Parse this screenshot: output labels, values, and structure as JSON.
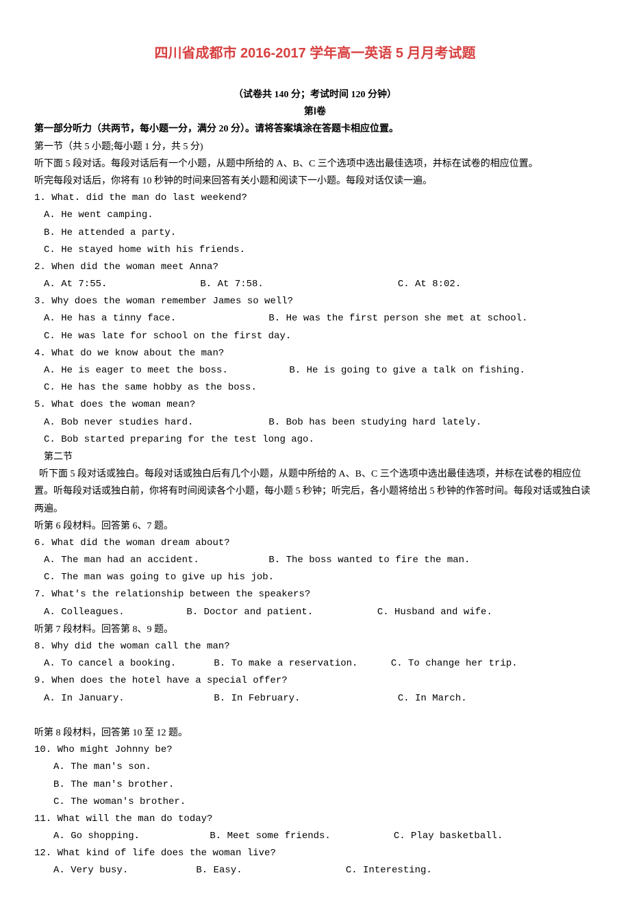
{
  "title": "四川省成都市 2016-2017 学年高一英语 5 月月考试题",
  "meta": "（试卷共 140 分；考试时间 120 分钟）",
  "volume": "第Ⅰ卷",
  "part1_header": "第一部分听力（共两节，每小题一分，满分 20 分）。请将答案填涂在答题卡相应位置。",
  "sec1_header": "第一节（共 5 小题;每小题 1 分，共 5 分)",
  "sec1_instr1": "听下面 5 段对话。每段对话后有一个小题，从题中所给的 A、B、C 三个选项中选出最佳选项，并标在试卷的相应位置。",
  "sec1_instr2": "听完每段对话后，你将有 10 秒钟的时间来回答有关小题和阅读下一小题。每段对话仅读一遍。",
  "q1": {
    "stem": "1. What. did the man do last weekend?",
    "a": "A. He went camping.",
    "b": "B. He attended a party.",
    "c": "C. He stayed home with his friends."
  },
  "q2": {
    "stem": "2. When did the woman meet Anna?",
    "a": "A. At 7:55.",
    "b": "B. At 7:58.",
    "c": "C. At 8:02."
  },
  "q3": {
    "stem": "3. Why does the woman remember James so well?",
    "a": "A. He has a tinny face.",
    "b": "B. He was the first person she met at school.",
    "c": "C. He was late for school on the first day."
  },
  "q4": {
    "stem": "4. What do we know about the man?",
    "a": "A. He is eager to meet the boss.",
    "b": "B. He is going to give a talk on fishing.",
    "c": "C. He has the same hobby as the boss."
  },
  "q5": {
    "stem": "5. What does the woman mean?",
    "a": "A. Bob never studies hard.",
    "b": "B. Bob has been studying hard lately.",
    "c": "C. Bob started preparing for the test long ago."
  },
  "sec2_header": "第二节",
  "sec2_instr": "  听下面 5 段对话或独白。每段对话或独白后有几个小题，从题中所给的 A、B、C 三个选项中选出最佳选项，并标在试卷的相应位置。听每段对话或独白前，你将有时间阅读各个小题，每小题 5 秒钟；听完后，各小题将给出 5 秒钟的作答时间。每段对话或独白读两遍。",
  "mat6": "听第 6 段材料。回答第 6、7 题。",
  "q6": {
    "stem": "6. What did the woman dream about?",
    "a": "A. The man had an accident.",
    "b": "B. The boss wanted to fire the man.",
    "c": "C. The man was going to give up his job."
  },
  "q7": {
    "stem": "7. What's the relationship between the speakers?",
    "a": "A. Colleagues.",
    "b": "B. Doctor and patient.",
    "c": "C. Husband and wife."
  },
  "mat7": "听第 7 段材料。回答第 8、9 题。",
  "q8": {
    "stem": "8. Why did the woman call the man?",
    "a": "A. To cancel a booking.",
    "b": "B. To make a reservation.",
    "c": "C. To change her trip."
  },
  "q9": {
    "stem": "9. When does the hotel have a special offer?",
    "a": "A. In January.",
    "b": "B. In February.",
    "c": "C. In March."
  },
  "mat8": "听第 8 段材料，回答第 10 至 12 题。",
  "q10": {
    "stem": "10. Who might Johnny be?",
    "a": "A. The man's son.",
    "b": "B. The man's brother.",
    "c": "C. The woman's brother."
  },
  "q11": {
    "stem": "11. What will the man do today?",
    "a": "A. Go shopping.",
    "b": "B. Meet some friends.",
    "c": "C. Play basketball."
  },
  "q12": {
    "stem": "12. What kind of life does the woman live?",
    "a": "A. Very busy.",
    "b": "B. Easy.",
    "c": "C. Interesting."
  }
}
